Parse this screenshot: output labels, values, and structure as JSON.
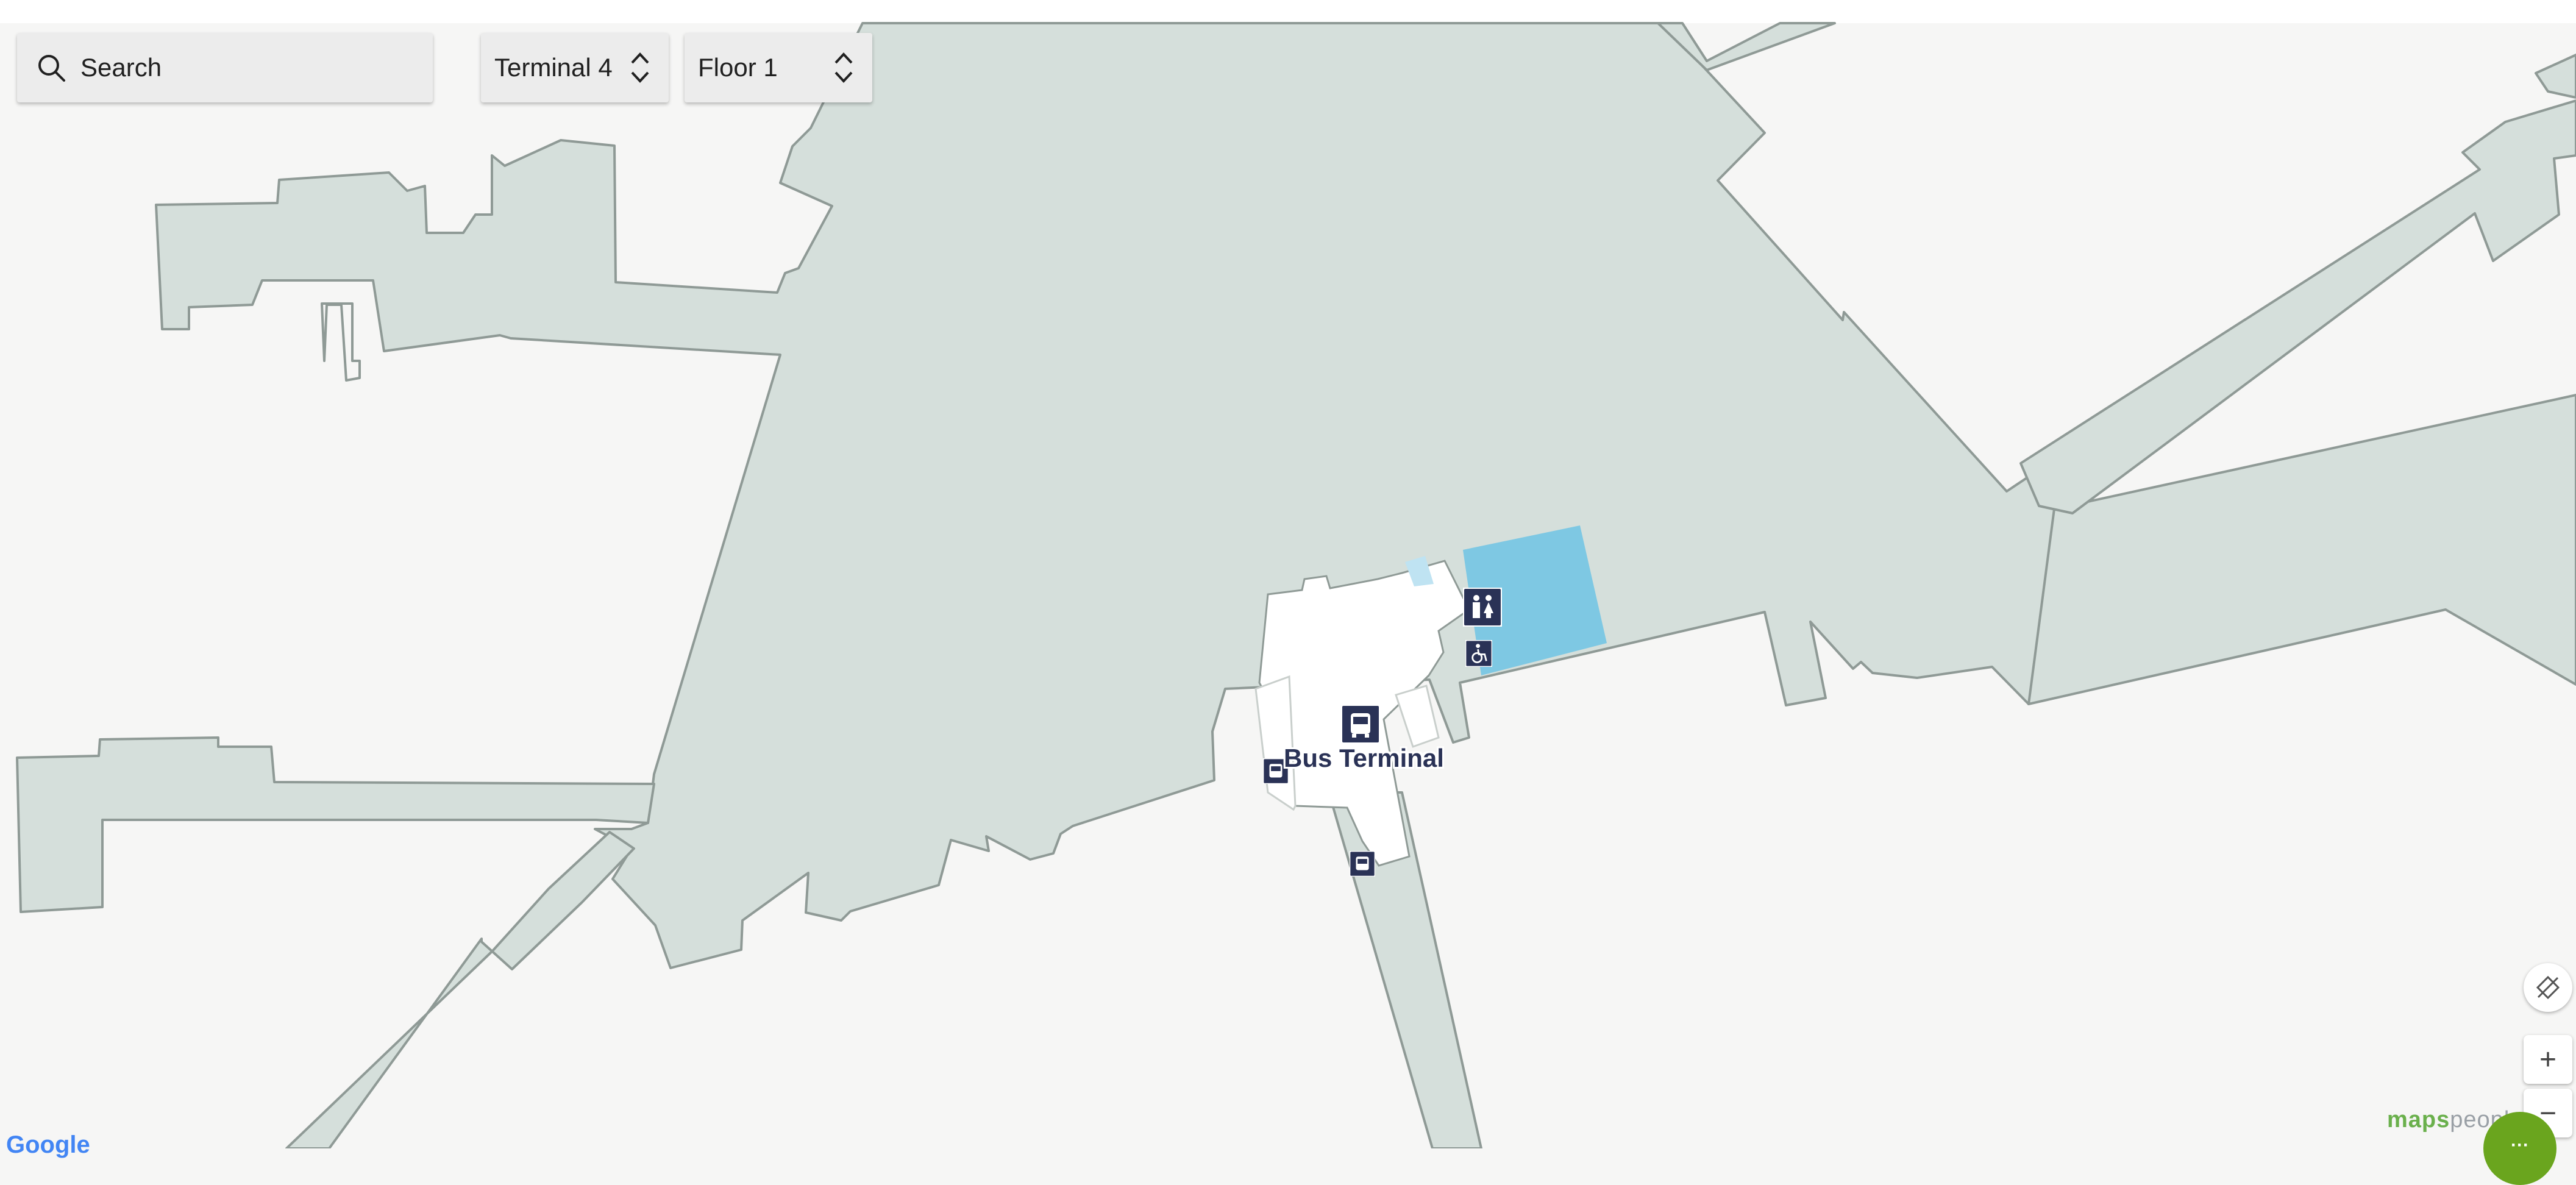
{
  "search": {
    "label": "Search",
    "icon": "search-icon"
  },
  "venue_selector": {
    "value": "Terminal 4",
    "icon": "chevron-up-down-icon"
  },
  "floor_selector": {
    "value": "Floor 1",
    "icon": "chevron-up-down-icon"
  },
  "map": {
    "poi_label": "Bus Terminal",
    "icons": [
      "bus-icon",
      "restroom-icon",
      "accessible-icon"
    ],
    "colors": {
      "background": "#f6f6f5",
      "building": "#d5dfdb",
      "outline": "#8f9a96",
      "highlight": "#7ec8e3",
      "poi": "#2a3256"
    }
  },
  "controls": {
    "rotate_icon": "compass-reset-icon",
    "zoom_in_label": "+",
    "zoom_out_label": "−"
  },
  "branding": {
    "maps": "maps",
    "people": "people"
  },
  "attribution": "Google"
}
